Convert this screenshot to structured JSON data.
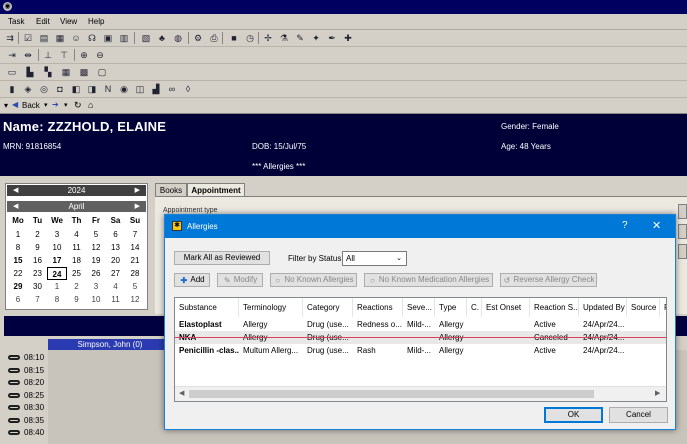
{
  "menu": [
    "Task",
    "Edit",
    "View",
    "Help"
  ],
  "nav": {
    "back_label": "Back",
    "forward_glyph": "➔"
  },
  "patient": {
    "name": "Name: ZZZHOLD, ELAINE",
    "mrn": "MRN: 91816854",
    "dob": "DOB: 15/Jul/75",
    "gender": "Gender: Female",
    "age": "Age:  48 Years",
    "allergies": "*** Allergies ***"
  },
  "calendar": {
    "year": "2024",
    "month": "April",
    "dow": [
      "Mo",
      "Tu",
      "We",
      "Th",
      "Fr",
      "Sa",
      "Su"
    ],
    "weeks": [
      [
        "1",
        "2",
        "3",
        "4",
        "5",
        "6",
        "7"
      ],
      [
        "8",
        "9",
        "10",
        "11",
        "12",
        "13",
        "14"
      ],
      [
        "15",
        "16",
        "17",
        "18",
        "19",
        "20",
        "21"
      ],
      [
        "22",
        "23",
        "24",
        "25",
        "26",
        "27",
        "28"
      ],
      [
        "29",
        "30",
        "1",
        "2",
        "3",
        "4",
        "5"
      ],
      [
        "6",
        "7",
        "8",
        "9",
        "10",
        "11",
        "12"
      ]
    ]
  },
  "tabs": {
    "books": "Books",
    "appointment": "Appointment"
  },
  "appointment_type_label": "Appointment type",
  "schedule": {
    "resource": "Simpson, John (0)",
    "times": [
      "08:10",
      "08:15",
      "08:20",
      "08:25",
      "08:30",
      "08:35",
      "08:40"
    ]
  },
  "dialog": {
    "title": "Allergies",
    "help_glyph": "?",
    "close_glyph": "✕",
    "mark_all_label": "Mark All as Reviewed",
    "filter_label": "Filter by Status",
    "filter_value": "All",
    "buttons": {
      "add": "Add",
      "modify": "Modify",
      "nka": "No Known Allergies",
      "nkma": "No Known Medication Allergies",
      "reverse": "Reverse Allergy Check"
    },
    "columns": [
      "Substance",
      "Terminology",
      "Category",
      "Reactions",
      "Seve...",
      "Type",
      "C.",
      "Est Onset",
      "Reaction S...",
      "Updated By",
      "Source",
      "R"
    ],
    "rows": [
      {
        "substance": "Elastoplast",
        "terminology": "Allergy",
        "category": "Drug (use...",
        "reactions": "Redness o...",
        "severity": "Mild-...",
        "type": "Allergy",
        "status": "Active",
        "updated": "24/Apr/24..."
      },
      {
        "substance": "NKA",
        "terminology": "Allergy",
        "category": "Drug (use...",
        "reactions": "",
        "severity": "",
        "type": "Allergy",
        "status": "Canceled",
        "updated": "24/Apr/24..."
      },
      {
        "substance": "Penicillin -clas...",
        "terminology": "Multum Allerg...",
        "category": "Drug (use...",
        "reactions": "Rash",
        "severity": "Mild-...",
        "type": "Allergy",
        "status": "Active",
        "updated": "24/Apr/24..."
      }
    ],
    "ok_label": "OK",
    "cancel_label": "Cancel"
  }
}
